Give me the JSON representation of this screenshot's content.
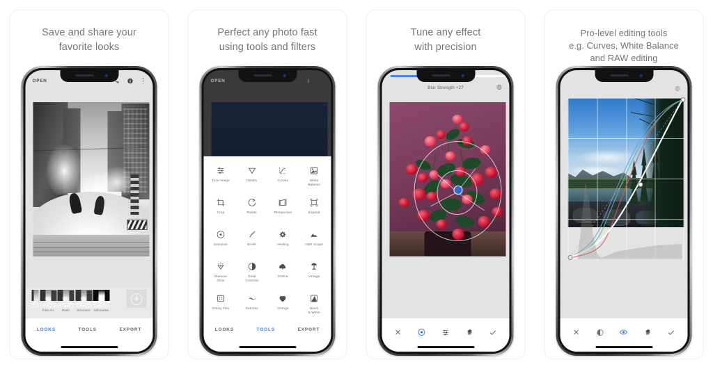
{
  "gallery": {
    "panels": [
      {
        "caption": "Save and share your\nfavorite looks",
        "caption_line1": "Save and share your",
        "caption_line2": "favorite looks",
        "app": {
          "open_label": "OPEN",
          "icons": [
            "undo-icon",
            "info-icon",
            "overflow-menu-icon"
          ],
          "photo": "black-and-white-city-snow-steam",
          "filter_strip": {
            "presets": [
              {
                "label": "Fine Art"
              },
              {
                "label": "Push"
              },
              {
                "label": "Structure"
              },
              {
                "label": "Silhouette"
              }
            ],
            "add_button": "add-preset-icon"
          },
          "tabs": [
            {
              "label": "LOOKS",
              "active": true
            },
            {
              "label": "TOOLS",
              "active": false
            },
            {
              "label": "EXPORT",
              "active": false
            }
          ]
        }
      },
      {
        "caption_line1": "Perfect any photo fast",
        "caption_line2": "using tools and filters",
        "app": {
          "open_label": "OPEN",
          "icons": [
            "undo-icon",
            "info-icon",
            "overflow-menu-icon"
          ],
          "photo": "dimmed-dark-photo",
          "tools": [
            {
              "label": "Tune Image",
              "icon": "tune-sliders-icon"
            },
            {
              "label": "Details",
              "icon": "triangle-details-icon"
            },
            {
              "label": "Curves",
              "icon": "curves-icon"
            },
            {
              "label": "White\nBalance",
              "icon": "white-balance-icon"
            },
            {
              "label": "Crop",
              "icon": "crop-icon"
            },
            {
              "label": "Rotate",
              "icon": "rotate-icon"
            },
            {
              "label": "Perspective",
              "icon": "perspective-icon"
            },
            {
              "label": "Expand",
              "icon": "expand-icon"
            },
            {
              "label": "Selective",
              "icon": "selective-target-icon"
            },
            {
              "label": "Brush",
              "icon": "brush-icon"
            },
            {
              "label": "Healing",
              "icon": "healing-icon"
            },
            {
              "label": "HDR Scape",
              "icon": "hdr-mountain-icon"
            },
            {
              "label": "Glamour\nGlow",
              "icon": "glamour-glow-icon"
            },
            {
              "label": "Tonal\nContrast",
              "icon": "tonal-contrast-icon"
            },
            {
              "label": "Drama",
              "icon": "drama-cloud-icon"
            },
            {
              "label": "Vintage",
              "icon": "vintage-lamp-icon"
            },
            {
              "label": "Grainy Film",
              "icon": "grainy-film-icon"
            },
            {
              "label": "Retrolux",
              "icon": "retrolux-icon"
            },
            {
              "label": "Grunge",
              "icon": "grunge-heart-icon"
            },
            {
              "label": "Black\n& White",
              "icon": "black-and-white-icon"
            }
          ],
          "tabs": [
            {
              "label": "LOOKS",
              "active": false
            },
            {
              "label": "TOOLS",
              "active": true
            },
            {
              "label": "EXPORT",
              "active": false
            }
          ]
        }
      },
      {
        "caption_line1": "Tune any effect",
        "caption_line2": "with precision",
        "app": {
          "effect_title": "Blur Strength +27",
          "slider_percent": 40,
          "slider_color": "#4285f4",
          "compare_icon": "compare-icon",
          "photo": "red-crown-of-thorns-flowers-purple-wall",
          "selective_control": "selective-edit-point",
          "toolbar": [
            {
              "icon": "close-icon",
              "active": false
            },
            {
              "icon": "selective-target-icon",
              "active": true
            },
            {
              "icon": "tune-sliders-icon",
              "active": false
            },
            {
              "icon": "stack-layers-icon",
              "active": false
            },
            {
              "icon": "check-icon",
              "active": false
            }
          ]
        }
      },
      {
        "caption_line1": "Pro-level editing tools",
        "caption_line2": "e.g. Curves, White Balance",
        "caption_line3": "and RAW editing",
        "app": {
          "compare_icon": "compare-icon",
          "photo": "mountain-lake-pine-trees-landscape",
          "curves": {
            "channels": [
              "luminance",
              "red",
              "green",
              "blue"
            ],
            "control_points": [
              {
                "x": 0.0,
                "y": 0.0
              },
              {
                "x": 0.62,
                "y": 0.62
              },
              {
                "x": 1.0,
                "y": 1.0
              }
            ],
            "grid": "4x4",
            "histogram": true
          },
          "toolbar": [
            {
              "icon": "close-icon",
              "active": false
            },
            {
              "icon": "half-circle-icon",
              "active": false
            },
            {
              "icon": "eye-icon",
              "active": true
            },
            {
              "icon": "stack-layers-icon",
              "active": false
            },
            {
              "icon": "check-icon",
              "active": false
            }
          ]
        }
      }
    ]
  },
  "colors": {
    "accent": "#3b78e7",
    "slider": "#4285f4",
    "caption": "#757575",
    "screen_bg": "#e3e3e3",
    "sheet_bg": "#ffffff"
  }
}
